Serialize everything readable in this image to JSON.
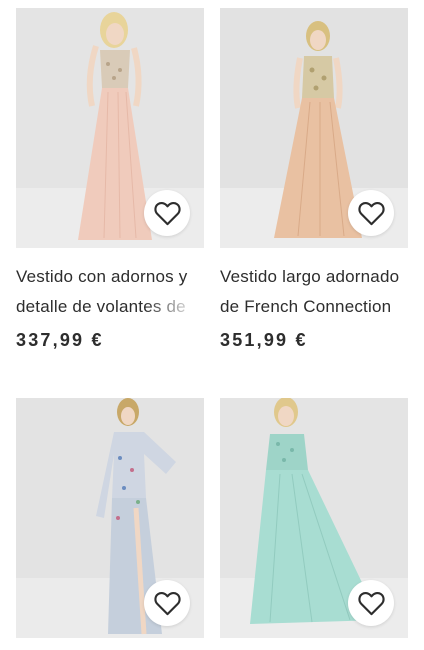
{
  "products": [
    {
      "title_line1": "Vestido con adornos y",
      "title_line2": "detalle de volantes de",
      "price": "337,99 €",
      "wishlist_icon": "heart-outline-icon"
    },
    {
      "title_line1": "Vestido largo adornado",
      "title_line2": "de French Connection",
      "price": "351,99 €",
      "wishlist_icon": "heart-outline-icon"
    },
    {
      "wishlist_icon": "heart-outline-icon"
    },
    {
      "wishlist_icon": "heart-outline-icon"
    }
  ],
  "colors": {
    "text": "#2d2d2d",
    "photo_bg": "#e6e6e6",
    "dress1": "#efcdbd",
    "dress2": "#e8bf9f",
    "dress3": "#c9d3e0",
    "dress4": "#a9ddd3"
  }
}
